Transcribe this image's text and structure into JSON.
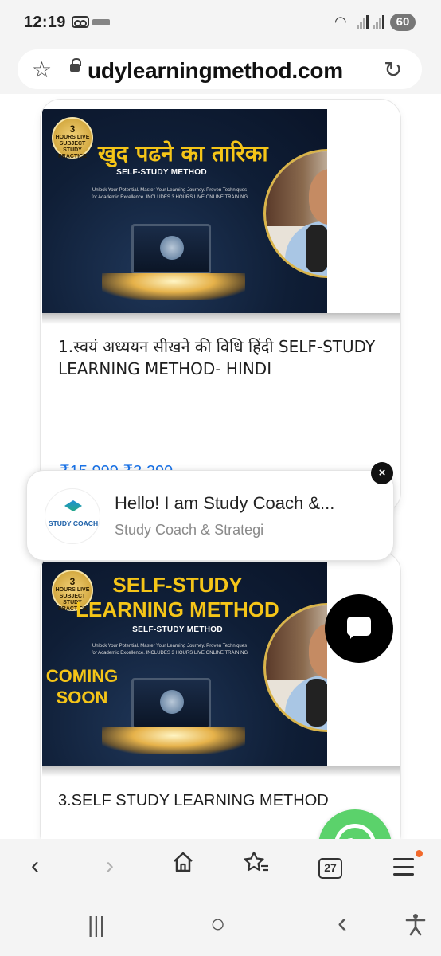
{
  "status_bar": {
    "time": "12:19",
    "battery": "60",
    "icons": [
      "voicemail-icon",
      "wifi-icon",
      "signal-icon",
      "battery-icon"
    ]
  },
  "address_bar": {
    "url": "udylearningmethod.com",
    "icons": [
      "star-icon",
      "lock-icon",
      "reload-icon"
    ]
  },
  "cards": [
    {
      "badge_top": "3",
      "badge_text": "HOURS LIVE SUBJECT STUDY PRACTICE",
      "banner_title": "खुद पढने का तारिका",
      "banner_subtitle": "SELF-STUDY METHOD",
      "banner_tagline": "Unlock Your Potential. Master Your Learning Journey. Proven Techniques for Academic Excellence. INCLUDES 3 HOURS LIVE ONLINE TRAINING",
      "title": "1.स्वयं अध्ययन सीखने की विधि हिंदी SELF-STUDY LEARNING METHOD- HINDI",
      "price": "₹15,999 ₹3,299"
    },
    {
      "badge_top": "3",
      "badge_text": "HOURS LIVE SUBJECT STUDY PRACTICE",
      "banner_title": "SELF-STUDY LEARNING METHOD",
      "banner_subtitle": "SELF-STUDY METHOD",
      "banner_tagline": "Unlock Your Potential. Master Your Learning Journey. Proven Techniques for Academic Excellence. INCLUDES 3 HOURS LIVE ONLINE TRAINING",
      "coming_soon": "COMING SOON",
      "title": "3.SELF STUDY LEARNING METHOD"
    }
  ],
  "chat_popup": {
    "title": "Hello! I am Study Coach &...",
    "subtitle": "Study Coach & Strategi",
    "avatar_text": "STUDY COACH",
    "close": "×"
  },
  "toolbar": {
    "back": "‹",
    "forward": "›",
    "tab_count": "27"
  },
  "navbar": {
    "recents": "|||",
    "home": "○",
    "back": "‹"
  }
}
